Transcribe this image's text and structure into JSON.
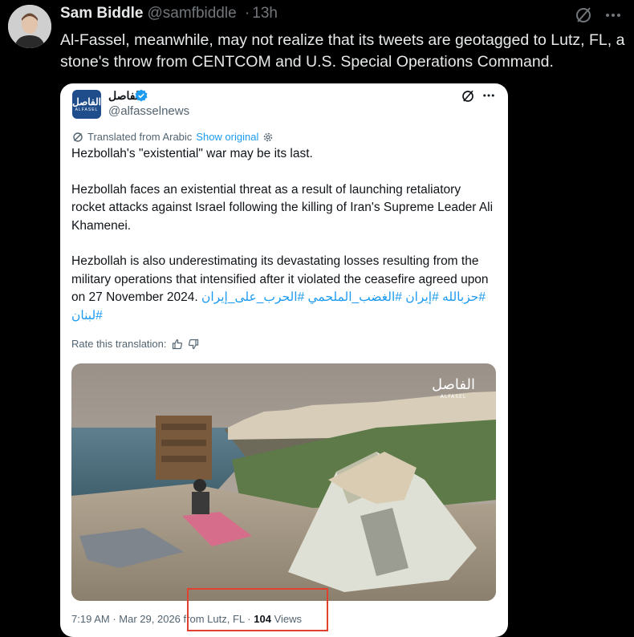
{
  "tweet": {
    "author_name": "Sam Biddle",
    "author_handle": "@samfbiddle",
    "separator": "·",
    "time": "13h",
    "text": "Al-Fassel, meanwhile, may not realize that its tweets are geotagged to Lutz, FL, a stone's throw from CENTCOM and U.S. Special Operations Command."
  },
  "quoted": {
    "author_name": "الفاصل",
    "author_handle": "@alfasselnews",
    "logo_text": "الفاصل",
    "logo_sub": "ALFASEL",
    "translated_label": "Translated from Arabic",
    "show_original": "Show original",
    "paragraphs": [
      "Hezbollah's \"existential\" war may be its last.",
      "Hezbollah faces an existential threat as a result of launching retaliatory rocket attacks against Israel following the killing of Iran's Supreme Leader Ali Khamenei."
    ],
    "last_paragraph": "Hezbollah is also underestimating its devastating losses resulting from the military operations that intensified after it violated the ceasefire agreed upon on 27 November 2024.",
    "hashtags": "#حزبالله #إيران #الغضب_الملحمي #الحرب_على_إيران #لبنان",
    "rate_label": "Rate this translation:",
    "photo_watermark": "الفاصل",
    "photo_watermark_sub": "ALFASEL",
    "time": "7:19 AM",
    "date": "Mar 29, 2026",
    "location": "from Lutz, FL",
    "views_count": "104",
    "views_label": "Views"
  },
  "colors": {
    "background": "#000000",
    "text": "#e7e9ea",
    "muted": "#71767b",
    "link": "#1d9bf0",
    "verified": "#1d9bf0",
    "highlight_box": "#e0402e"
  }
}
